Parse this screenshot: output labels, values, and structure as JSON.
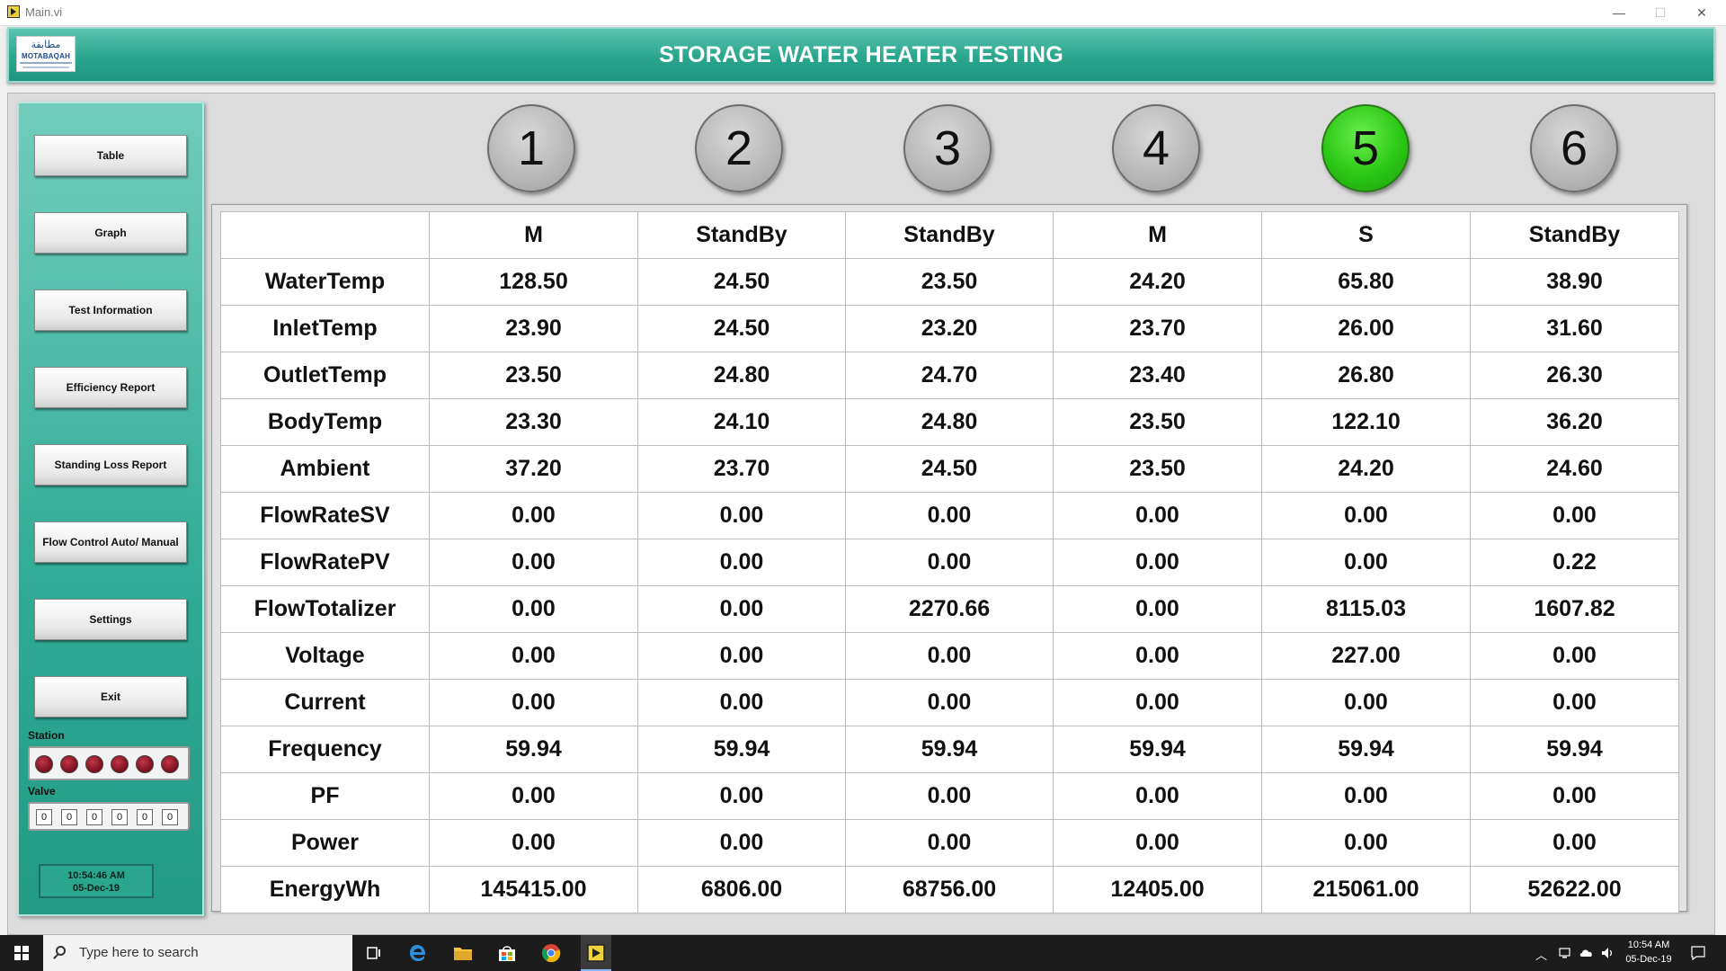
{
  "window": {
    "title": "Main.vi",
    "minimize": "—",
    "maximize": "☐",
    "close": "✕"
  },
  "header": {
    "title": "STORAGE WATER HEATER TESTING",
    "logo": {
      "arabic": "مطابقة",
      "name": "MOTABAQAH"
    }
  },
  "sidebar": {
    "buttons": [
      "Table",
      "Graph",
      "Test Information",
      "Efficiency Report",
      "Standing Loss Report",
      "Flow Control Auto/ Manual",
      "Settings",
      "Exit"
    ],
    "station_label": "Station",
    "valve_label": "Valve",
    "valve_values": [
      "0",
      "0",
      "0",
      "0",
      "0",
      "0"
    ],
    "clock": {
      "time": "10:54:46 AM",
      "date": "05-Dec-19"
    }
  },
  "stations": {
    "numbers": [
      "1",
      "2",
      "3",
      "4",
      "5",
      "6"
    ],
    "active_index": 4,
    "active_color": "#2bc715"
  },
  "table": {
    "modes": [
      "M",
      "StandBy",
      "StandBy",
      "M",
      "S",
      "StandBy"
    ],
    "rows": [
      {
        "label": "WaterTemp",
        "values": [
          "128.50",
          "24.50",
          "23.50",
          "24.20",
          "65.80",
          "38.90"
        ]
      },
      {
        "label": "InletTemp",
        "values": [
          "23.90",
          "24.50",
          "23.20",
          "23.70",
          "26.00",
          "31.60"
        ]
      },
      {
        "label": "OutletTemp",
        "values": [
          "23.50",
          "24.80",
          "24.70",
          "23.40",
          "26.80",
          "26.30"
        ]
      },
      {
        "label": "BodyTemp",
        "values": [
          "23.30",
          "24.10",
          "24.80",
          "23.50",
          "122.10",
          "36.20"
        ]
      },
      {
        "label": "Ambient",
        "values": [
          "37.20",
          "23.70",
          "24.50",
          "23.50",
          "24.20",
          "24.60"
        ]
      },
      {
        "label": "FlowRateSV",
        "values": [
          "0.00",
          "0.00",
          "0.00",
          "0.00",
          "0.00",
          "0.00"
        ]
      },
      {
        "label": "FlowRatePV",
        "values": [
          "0.00",
          "0.00",
          "0.00",
          "0.00",
          "0.00",
          "0.22"
        ]
      },
      {
        "label": "FlowTotalizer",
        "values": [
          "0.00",
          "0.00",
          "2270.66",
          "0.00",
          "8115.03",
          "1607.82"
        ]
      },
      {
        "label": "Voltage",
        "values": [
          "0.00",
          "0.00",
          "0.00",
          "0.00",
          "227.00",
          "0.00"
        ]
      },
      {
        "label": "Current",
        "values": [
          "0.00",
          "0.00",
          "0.00",
          "0.00",
          "0.00",
          "0.00"
        ]
      },
      {
        "label": "Frequency",
        "values": [
          "59.94",
          "59.94",
          "59.94",
          "59.94",
          "59.94",
          "59.94"
        ]
      },
      {
        "label": "PF",
        "values": [
          "0.00",
          "0.00",
          "0.00",
          "0.00",
          "0.00",
          "0.00"
        ]
      },
      {
        "label": "Power",
        "values": [
          "0.00",
          "0.00",
          "0.00",
          "0.00",
          "0.00",
          "0.00"
        ]
      },
      {
        "label": "EnergyWh",
        "values": [
          "145415.00",
          "6806.00",
          "68756.00",
          "12405.00",
          "215061.00",
          "52622.00"
        ]
      }
    ]
  },
  "taskbar": {
    "search_placeholder": "Type here to search",
    "time": "10:54 AM",
    "date": "05-Dec-19"
  }
}
